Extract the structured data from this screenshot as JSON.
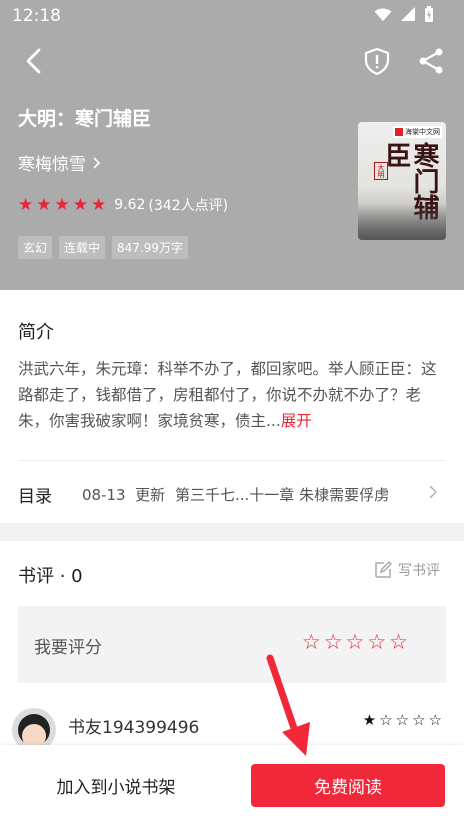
{
  "status_bar": {
    "time": "12:18"
  },
  "book": {
    "title": "大明：寒门辅臣",
    "author": "寒梅惊雪",
    "rating_score": "9.62",
    "rating_count": "(342人点评)",
    "rating_stars_filled": 5,
    "tags": [
      "玄幻",
      "连载中",
      "847.99万字"
    ],
    "cover": {
      "badge": "海棠中文网",
      "title": "寒门辅臣",
      "seal": "大明"
    }
  },
  "intro": {
    "heading": "简介",
    "text": "洪武六年，朱元璋：科举不办了，都回家吧。举人顾正臣：这路都走了，钱都借了，房租都付了，你说不办就不办了？老朱，你害我破家啊！家境贫寒，债主...",
    "expand_label": "展开"
  },
  "toc": {
    "label": "目录",
    "update_date": "08-13",
    "update_word": "更新",
    "latest_chapter": "第三千七...十一章 朱棣需要俘虏"
  },
  "reviews": {
    "heading": "书评 · 0",
    "write_label": "写书评",
    "rate_label": "我要评分",
    "rate_stars_filled": 0,
    "reviewer": {
      "name": "书友194399496",
      "stars_filled": 1
    }
  },
  "bottom_bar": {
    "add_to_shelf_label": "加入到小说书架",
    "read_label": "免费阅读"
  },
  "colors": {
    "accent": "#f0283a",
    "header_bg": "#ababab",
    "expand_link": "#e8263a"
  }
}
